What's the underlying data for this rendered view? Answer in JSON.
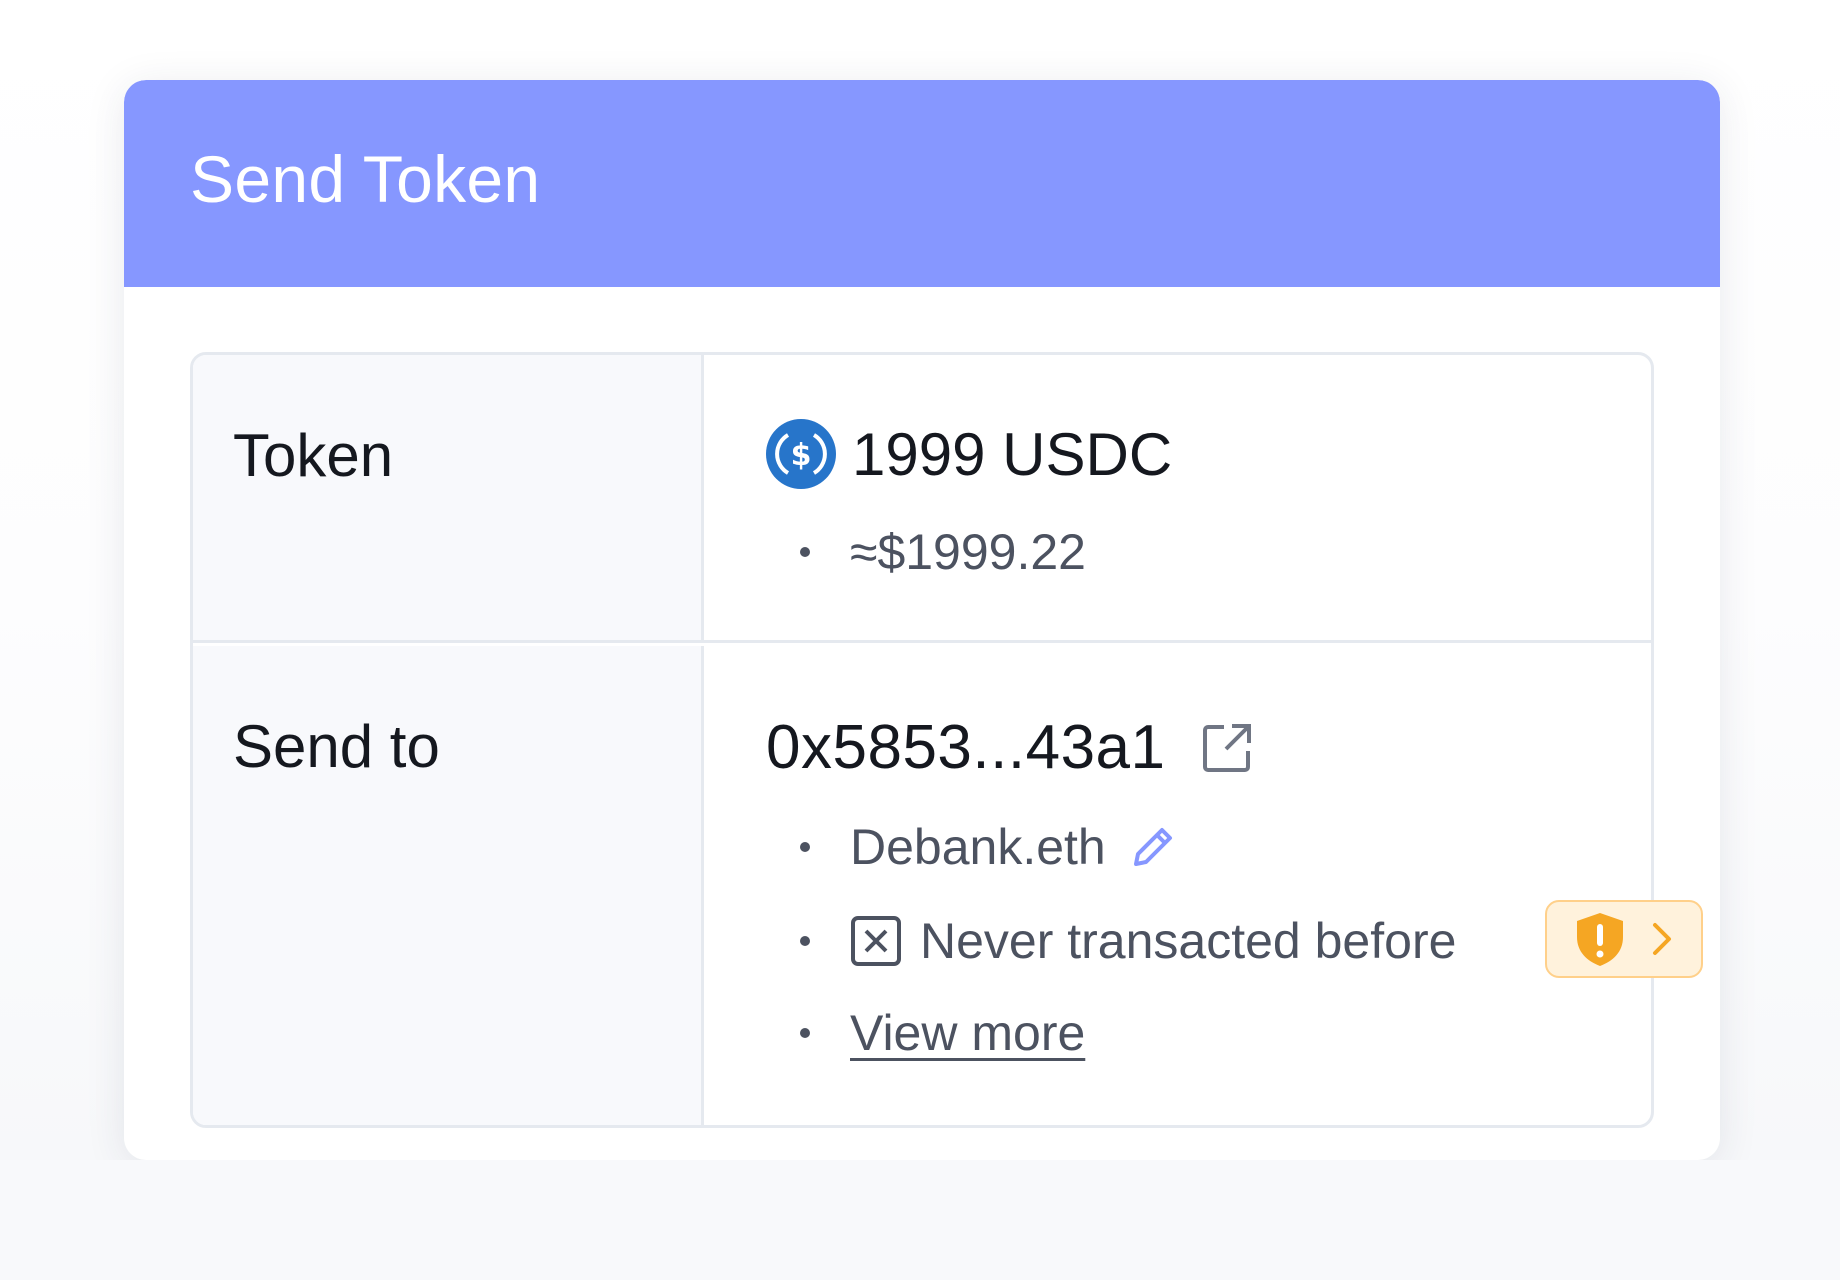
{
  "dialog": {
    "title": "Send Token",
    "header_color": "#8697ff"
  },
  "token_row": {
    "label": "Token",
    "icon": "usdc-icon",
    "amount": "1999 USDC",
    "usd_value": "≈$1999.22"
  },
  "send_row": {
    "label": "Send to",
    "address": "0x5853...43a1",
    "address_icon": "external-link-icon",
    "alias": "Debank.eth",
    "alias_icon": "pencil-icon",
    "history_icon": "x-box-icon",
    "history": "Never transacted before",
    "view_more": "View more",
    "warning_icon": "shield-warning-icon",
    "warning_color": "#f5a623"
  }
}
